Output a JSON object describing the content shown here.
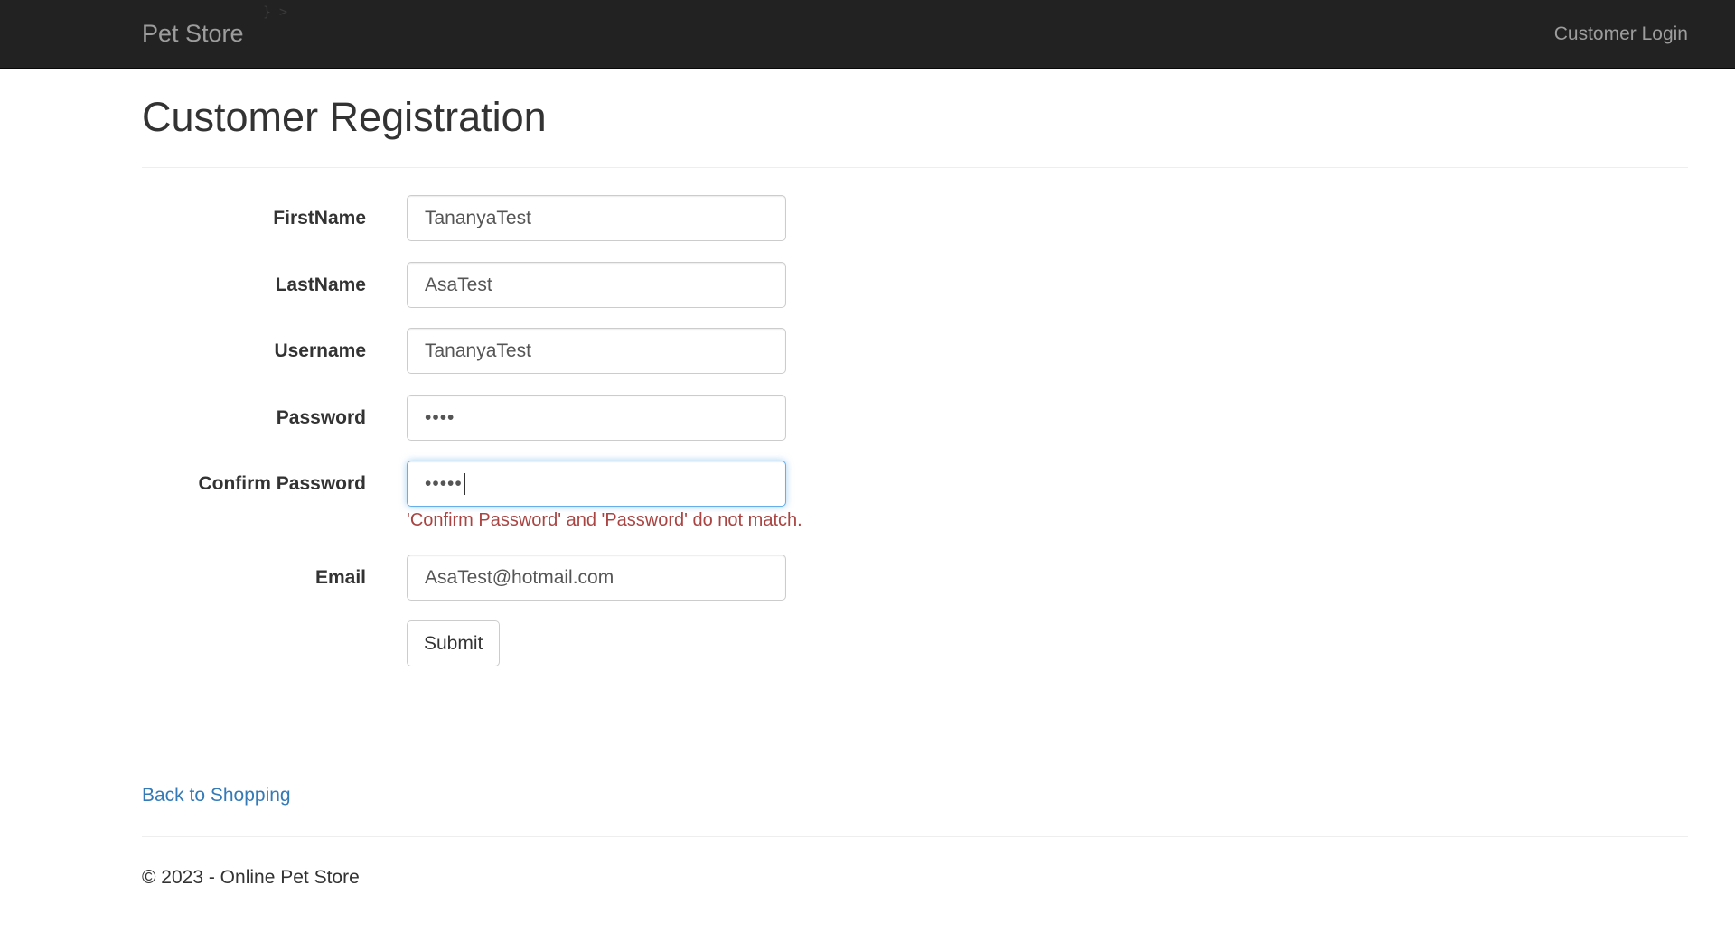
{
  "navbar": {
    "brand": "Pet Store",
    "brand_artifact": "} >",
    "login_link": "Customer Login"
  },
  "page": {
    "title": "Customer Registration"
  },
  "form": {
    "firstname_label": "FirstName",
    "firstname_value": "TananyaTest",
    "lastname_label": "LastName",
    "lastname_value": "AsaTest",
    "username_label": "Username",
    "username_value": "TananyaTest",
    "password_label": "Password",
    "password_value": "••••",
    "confirm_label": "Confirm Password",
    "confirm_value": "•••••",
    "confirm_error": "'Confirm Password' and 'Password' do not match.",
    "email_label": "Email",
    "email_value": "AsaTest@hotmail.com",
    "submit_label": "Submit"
  },
  "links": {
    "back": "Back to Shopping"
  },
  "footer": {
    "text": "© 2023 - Online Pet Store"
  },
  "colors": {
    "navbar_bg": "#222222",
    "nav_text": "#9d9d9d",
    "link": "#337ab7",
    "error": "#a94442",
    "focus_border": "#66afe9"
  }
}
